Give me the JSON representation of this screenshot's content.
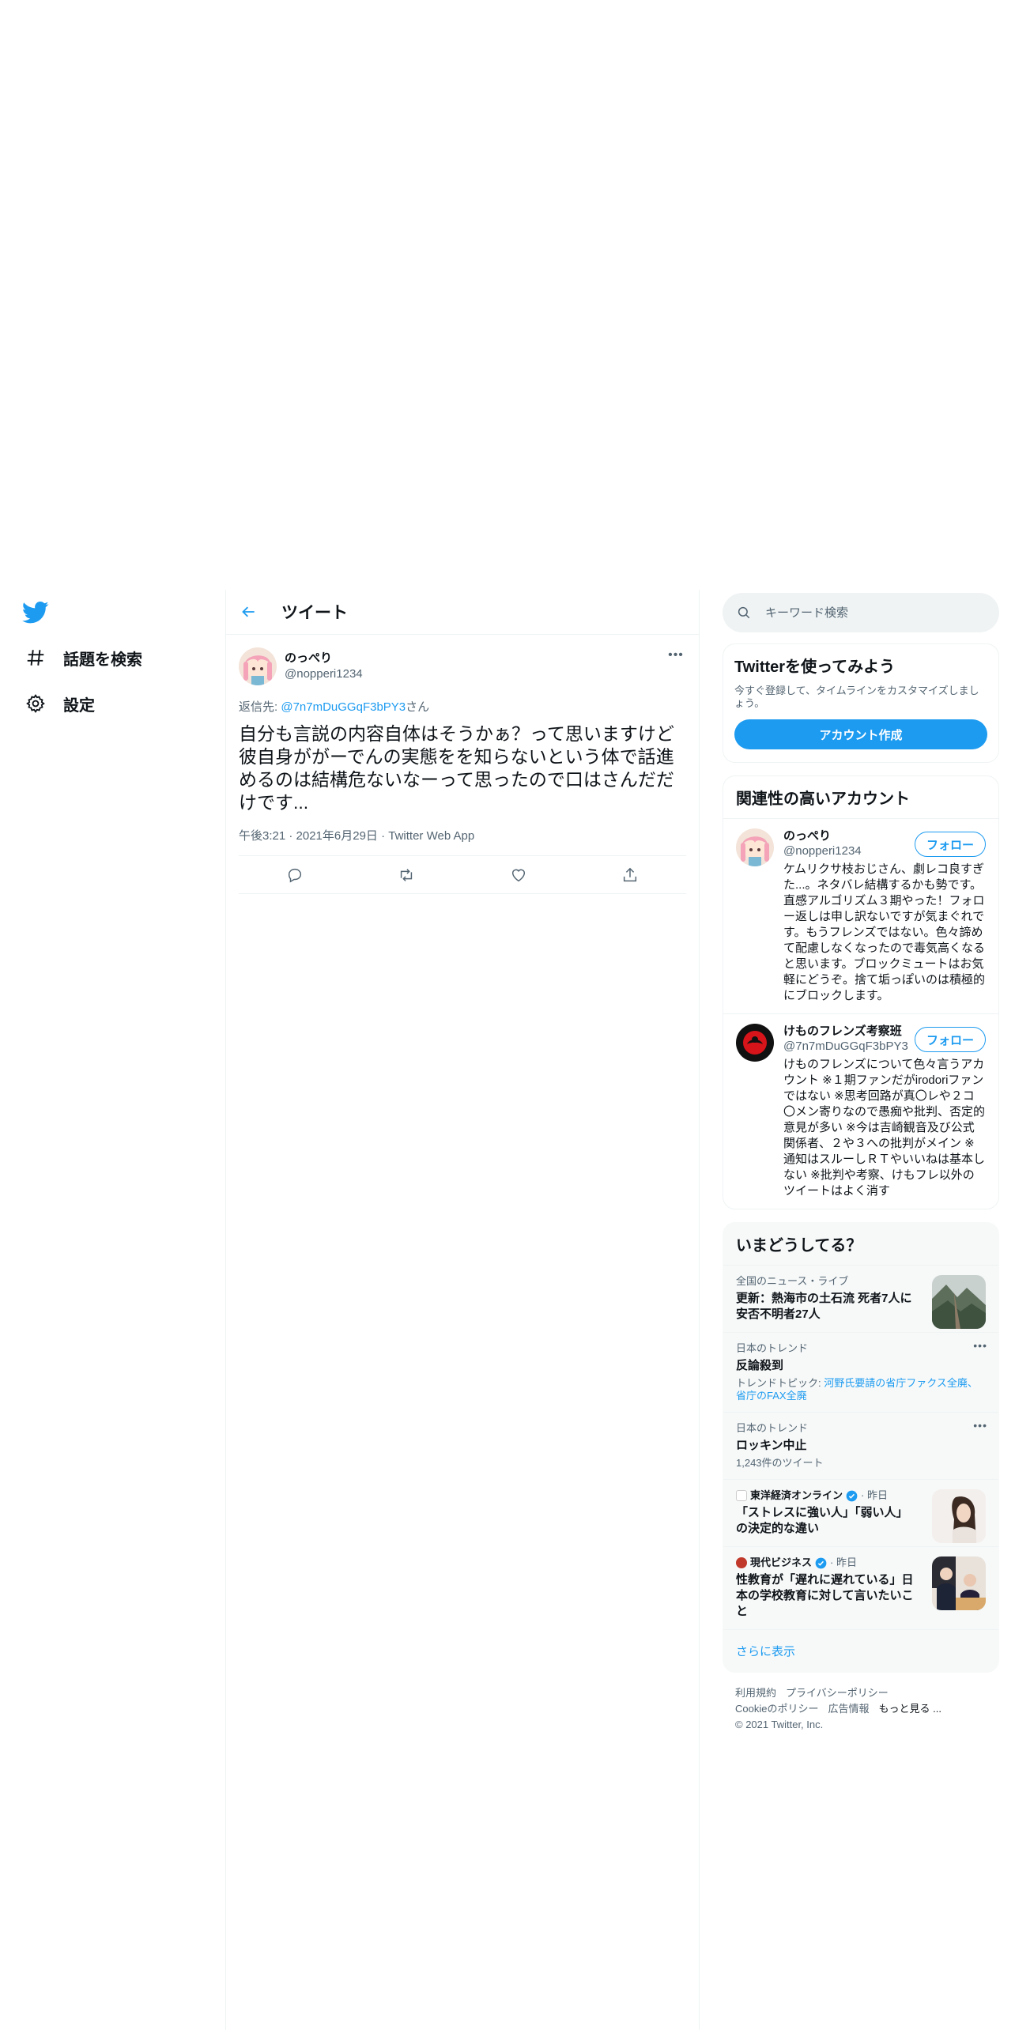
{
  "colors": {
    "accent": "#1d9bf0",
    "text": "#0f1419",
    "muted": "#536471",
    "border": "#eff3f4"
  },
  "nav": {
    "items": [
      {
        "icon": "hashtag-icon",
        "label": "話題を検索"
      },
      {
        "icon": "gear-icon",
        "label": "設定"
      }
    ]
  },
  "header": {
    "title": "ツイート"
  },
  "tweet": {
    "author_name": "のっぺり",
    "author_handle": "@nopperi1234",
    "reply_prefix": "返信先: ",
    "reply_mention": "@7n7mDuGGqF3bPY3",
    "reply_suffix": "さん",
    "text": "自分も言説の内容自体はそうかぁ？って思いますけど彼自身ががーでんの実態をを知らないという体で話進めるのは結構危ないなーって思ったので口はさんだだけです...",
    "meta": "午後3:21 · 2021年6月29日 · Twitter Web App"
  },
  "search": {
    "placeholder": "キーワード検索"
  },
  "signup": {
    "title": "Twitterを使ってみよう",
    "desc": "今すぐ登録して、タイムラインをカスタマイズしましょう。",
    "button": "アカウント作成"
  },
  "related": {
    "title": "関連性の高いアカウント",
    "follow_label": "フォロー",
    "users": [
      {
        "name": "のっぺり",
        "handle": "@nopperi1234",
        "bio": "ケムリクサ枝おじさん、劇レコ良すぎた...。ネタバレ結構するかも勢です。直感アルゴリズム３期やった！フォロー返しは申し訳ないですが気まぐれです。もうフレンズではない。色々諦めて配慮しなくなったので毒気高くなると思います。ブロックミュートはお気軽にどうぞ。捨て垢っぽいのは積極的にブロックします。"
      },
      {
        "name": "けものフレンズ考察班",
        "handle": "@7n7mDuGGqF3bPY3",
        "bio": "けものフレンズについて色々言うアカウント ※１期ファンだがirodoriファンではない ※思考回路が真〇レや２コ〇メン寄りなので愚痴や批判、否定的意見が多い ※今は吉崎観音及び公式関係者、２や３への批判がメイン ※通知はスルーしＲＴやいいねは基本しない ※批判や考察、けもフレ以外のツイートはよく消す"
      }
    ]
  },
  "trends": {
    "title": "いまどうしてる？",
    "items": [
      {
        "context": "全国のニュース・ライブ",
        "title": "更新：熱海市の土石流 死者7人に 安否不明者27人",
        "thumb": "mountain"
      },
      {
        "context": "日本のトレンド",
        "title": "反論殺到",
        "sub_prefix": "トレンドトピック: ",
        "sub_topic": "河野氏要請の省庁ファクス全廃、省庁のFAX全廃"
      },
      {
        "context": "日本のトレンド",
        "title": "ロッキン中止",
        "sub": "1,243件のツイート"
      },
      {
        "source": "東洋経済オンライン",
        "time": " · 昨日",
        "title": "「ストレスに強い人」「弱い人」の決定的な違い",
        "thumb": "woman"
      },
      {
        "source": "現代ビジネス",
        "time": " · 昨日",
        "title": "性教育が「遅れに遅れている」日本の学校教育に対して言いたいこと",
        "thumb": "classroom"
      }
    ],
    "show_more": "さらに表示"
  },
  "footer": {
    "links1": [
      "利用規約",
      "プライバシーポリシー"
    ],
    "links2": [
      "Cookieのポリシー",
      "広告情報",
      "もっと見る ..."
    ],
    "copyright": "© 2021 Twitter, Inc."
  }
}
